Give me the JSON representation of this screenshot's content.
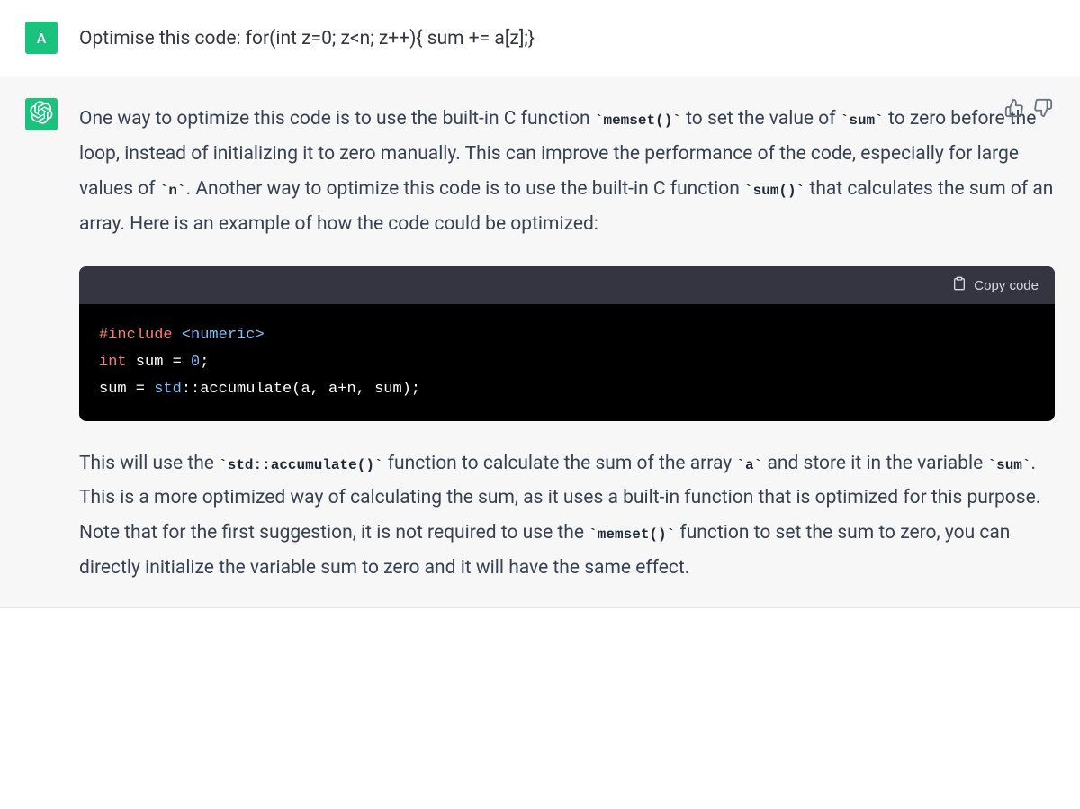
{
  "user": {
    "avatar_letter": "A",
    "message": "Optimise this code: for(int z=0; z<n; z++){ sum += a[z];}"
  },
  "assistant": {
    "p1_seg1": "One way to optimize this code is to use the built-in C function ",
    "p1_code1": "`memset()`",
    "p1_seg2": " to set the value of ",
    "p1_code2": "`sum`",
    "p1_seg3": " to zero before the loop, instead of initializing it to zero manually. This can improve the performance of the code, especially for large values of ",
    "p1_code3": "`n`",
    "p1_seg4": ". Another way to optimize this code is to use the built-in C function ",
    "p1_code4": "`sum()`",
    "p1_seg5": " that calculates the sum of an array. Here is an example of how the code could be optimized:",
    "copy_label": "Copy code",
    "code": {
      "l1a": "#include",
      "l1b": " <numeric>",
      "l2a": "int",
      "l2b": " sum = ",
      "l2c": "0",
      "l2d": ";",
      "l3a": "sum = ",
      "l3b": "std",
      "l3c": "::accumulate(a, a+n, sum);"
    },
    "p2_seg1": "This will use the ",
    "p2_code1": "`std::accumulate()`",
    "p2_seg2": " function to calculate the sum of the array ",
    "p2_code2": "`a`",
    "p2_seg3": " and store it in the variable ",
    "p2_code3": "`sum`",
    "p2_seg4": ". This is a more optimized way of calculating the sum, as it uses a built-in function that is optimized for this purpose.",
    "p3_seg1": "Note that for the first suggestion, it is not required to use the ",
    "p3_code1": "`memset()`",
    "p3_seg2": " function to set the sum to zero, you can directly initialize the variable sum to zero and it will have the same effect."
  }
}
